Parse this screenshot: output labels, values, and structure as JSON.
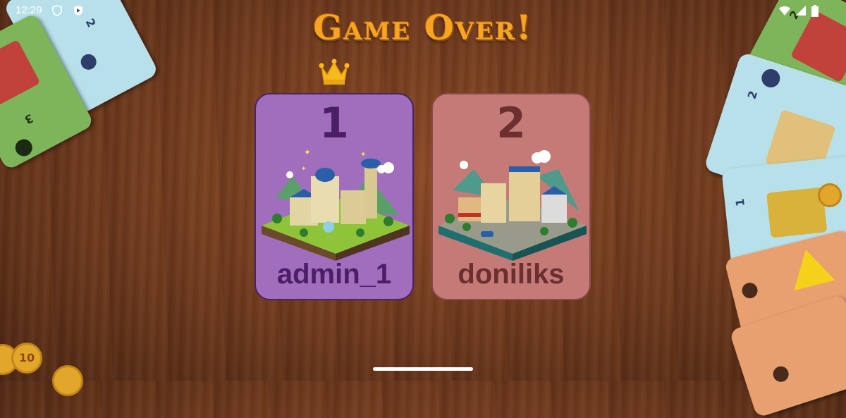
{
  "status_bar": {
    "time": "12:29",
    "icons": [
      "shield-icon",
      "play-protect-icon",
      "wifi-icon",
      "signal-icon",
      "battery-icon"
    ]
  },
  "title": "Game Over!",
  "winner_badge": "crown-icon",
  "players": [
    {
      "rank": "1",
      "name": "admin_1",
      "card_color": "#a06ebc",
      "text_color": "#4a1f66"
    },
    {
      "rank": "2",
      "name": "doniliks",
      "card_color": "#c47b78",
      "text_color": "#6a2f2e"
    }
  ],
  "decor": {
    "coin_value": "10",
    "left_card_numbers": [
      "2",
      "3"
    ],
    "right_card_numbers": [
      "2",
      "2",
      "1"
    ]
  },
  "colors": {
    "title": "#f7a520",
    "table_wood": "#6e3a1e",
    "card_blue": "#b8e0ea",
    "card_green": "#7fb55a",
    "card_orange": "#e8a070"
  }
}
